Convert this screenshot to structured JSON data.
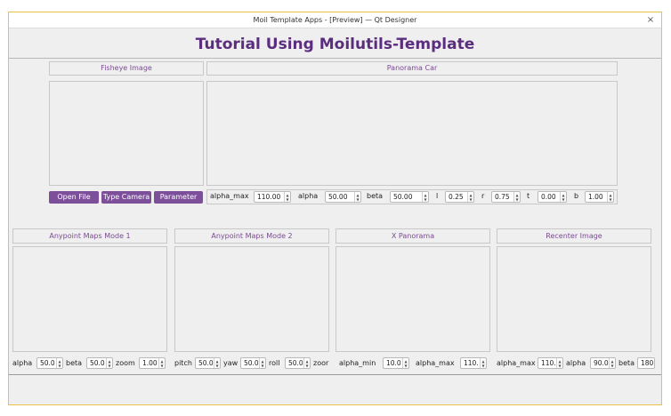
{
  "window": {
    "title": "Moil Template Apps - [Preview] — Qt Designer",
    "close_glyph": "×"
  },
  "app_title": "Tutorial Using Moilutils-Template",
  "top": {
    "fisheye_label": "Fisheye Image",
    "panorama_label": "Panorama Car",
    "buttons": {
      "open_file": "Open File",
      "type_camera": "Type Camera",
      "parameter": "Parameter"
    },
    "controls": [
      {
        "label": "alpha_max",
        "value": "110.00"
      },
      {
        "label": "alpha",
        "value": "50.00"
      },
      {
        "label": "beta",
        "value": "50.00"
      },
      {
        "label": "l",
        "value": "0.25"
      },
      {
        "label": "r",
        "value": "0.75"
      },
      {
        "label": "t",
        "value": "0.00"
      },
      {
        "label": "b",
        "value": "1.00"
      }
    ]
  },
  "bottom": {
    "panels": [
      {
        "label": "Anypoint Maps Mode 1",
        "controls": [
          {
            "label": "alpha",
            "value": "50.0"
          },
          {
            "label": "beta",
            "value": "50.0"
          },
          {
            "label": "zoom",
            "value": "1.00"
          }
        ]
      },
      {
        "label": "Anypoint Maps Mode 2",
        "controls": [
          {
            "label": "pitch",
            "value": "50.0"
          },
          {
            "label": "yaw",
            "value": "50.0"
          },
          {
            "label": "roll",
            "value": "50.0"
          },
          {
            "label": "zoor",
            "value": ""
          }
        ]
      },
      {
        "label": "X Panorama",
        "controls": [
          {
            "label": "alpha_min",
            "value": "10.0"
          },
          {
            "label": "alpha_max",
            "value": "110."
          }
        ]
      },
      {
        "label": "Recenter Image",
        "controls": [
          {
            "label": "alpha_max",
            "value": "110."
          },
          {
            "label": "alpha",
            "value": "90.0"
          },
          {
            "label": "beta",
            "value": "180"
          }
        ]
      }
    ]
  },
  "icons": {
    "spin_up": "▲",
    "spin_down": "▼"
  }
}
